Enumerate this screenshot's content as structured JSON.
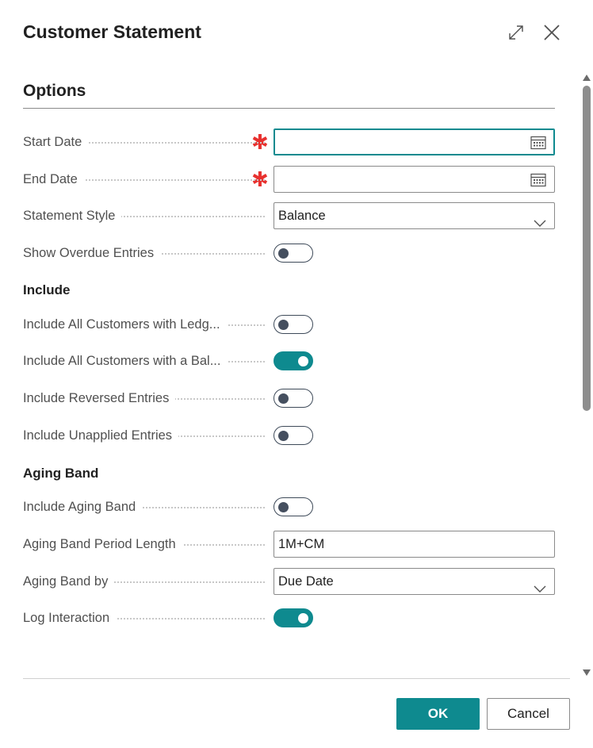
{
  "dialog": {
    "title": "Customer Statement",
    "header_icons": [
      "expand-icon",
      "close-icon"
    ]
  },
  "options": {
    "title": "Options",
    "start_date": {
      "label": "Start Date",
      "value": "",
      "required": true
    },
    "end_date": {
      "label": "End Date",
      "value": "",
      "required": true
    },
    "statement_style": {
      "label": "Statement Style",
      "value": "Balance"
    },
    "show_overdue": {
      "label": "Show Overdue Entries",
      "on": false
    }
  },
  "include": {
    "heading": "Include",
    "all_with_ledger": {
      "label": "Include All Customers with Ledg...",
      "on": false
    },
    "all_with_balance": {
      "label": "Include All Customers with a Bal...",
      "on": true
    },
    "reversed": {
      "label": "Include Reversed Entries",
      "on": false
    },
    "unapplied": {
      "label": "Include Unapplied Entries",
      "on": false
    }
  },
  "aging": {
    "heading": "Aging Band",
    "include_aging": {
      "label": "Include Aging Band",
      "on": false
    },
    "period_length": {
      "label": "Aging Band Period Length",
      "value": "1M+CM"
    },
    "aging_by": {
      "label": "Aging Band by",
      "value": "Due Date"
    },
    "log_interaction": {
      "label": "Log Interaction",
      "on": true
    }
  },
  "footer": {
    "ok_label": "OK",
    "cancel_label": "Cancel"
  },
  "colors": {
    "accent": "#0e8a8f",
    "required": "#e8312f"
  }
}
